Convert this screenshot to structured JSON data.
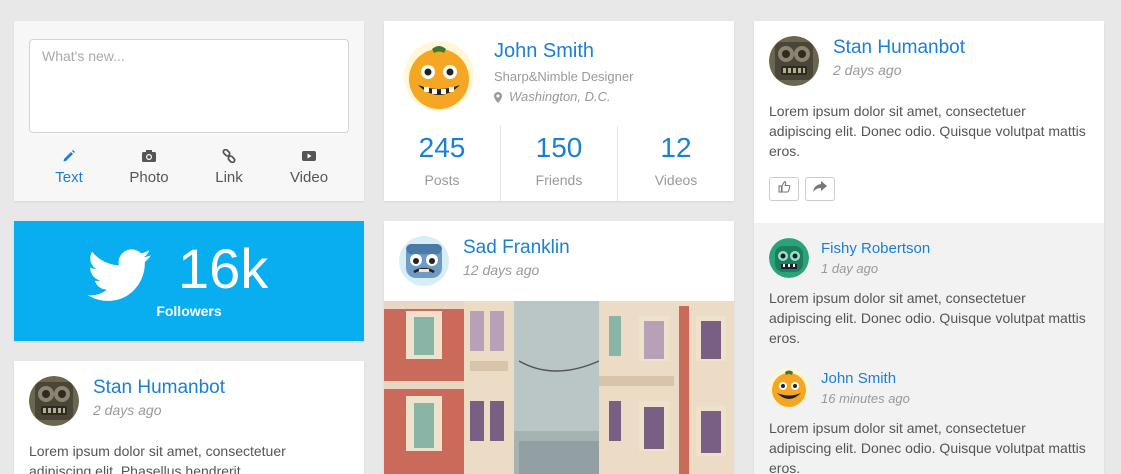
{
  "composer": {
    "placeholder": "What's new...",
    "tabs": [
      {
        "label": "Text",
        "icon": "pencil-icon",
        "active": true
      },
      {
        "label": "Photo",
        "icon": "camera-icon"
      },
      {
        "label": "Link",
        "icon": "link-icon"
      },
      {
        "label": "Video",
        "icon": "video-icon"
      }
    ]
  },
  "twitter": {
    "count": "16k",
    "label": "Followers",
    "icon": "twitter-bird-icon",
    "color": "#08aef0"
  },
  "post_left": {
    "author": "Stan Humanbot",
    "time": "2 days ago",
    "text_line1": "Lorem ipsum dolor sit amet, consectetuer",
    "text_line2": "adipiscing elit. Phasellus hendrerit."
  },
  "profile": {
    "name": "John Smith",
    "title": "Sharp&Nimble Designer",
    "location": "Washington, D.C.",
    "stats": [
      {
        "value": "245",
        "label": "Posts"
      },
      {
        "value": "150",
        "label": "Friends"
      },
      {
        "value": "12",
        "label": "Videos"
      }
    ]
  },
  "photo_post": {
    "author": "Sad Franklin",
    "time": "12 days ago"
  },
  "right_post": {
    "author": "Stan Humanbot",
    "time": "2 days ago",
    "text": "Lorem ipsum dolor sit amet, consectetuer adipiscing elit. Donec odio. Quisque volutpat mattis eros."
  },
  "comments": [
    {
      "author": "Fishy Robertson",
      "time": "1 day ago",
      "text": "Lorem ipsum dolor sit amet, consectetuer adipiscing elit. Donec odio. Quisque volutpat mattis eros."
    },
    {
      "author": "John Smith",
      "time": "16 minutes ago",
      "text": "Lorem ipsum dolor sit amet, consectetuer adipiscing elit. Donec odio. Quisque volutpat mattis eros."
    }
  ],
  "colors": {
    "accent": "#1a7fd6",
    "twitter": "#08aef0",
    "background": "#e8e8e8"
  }
}
